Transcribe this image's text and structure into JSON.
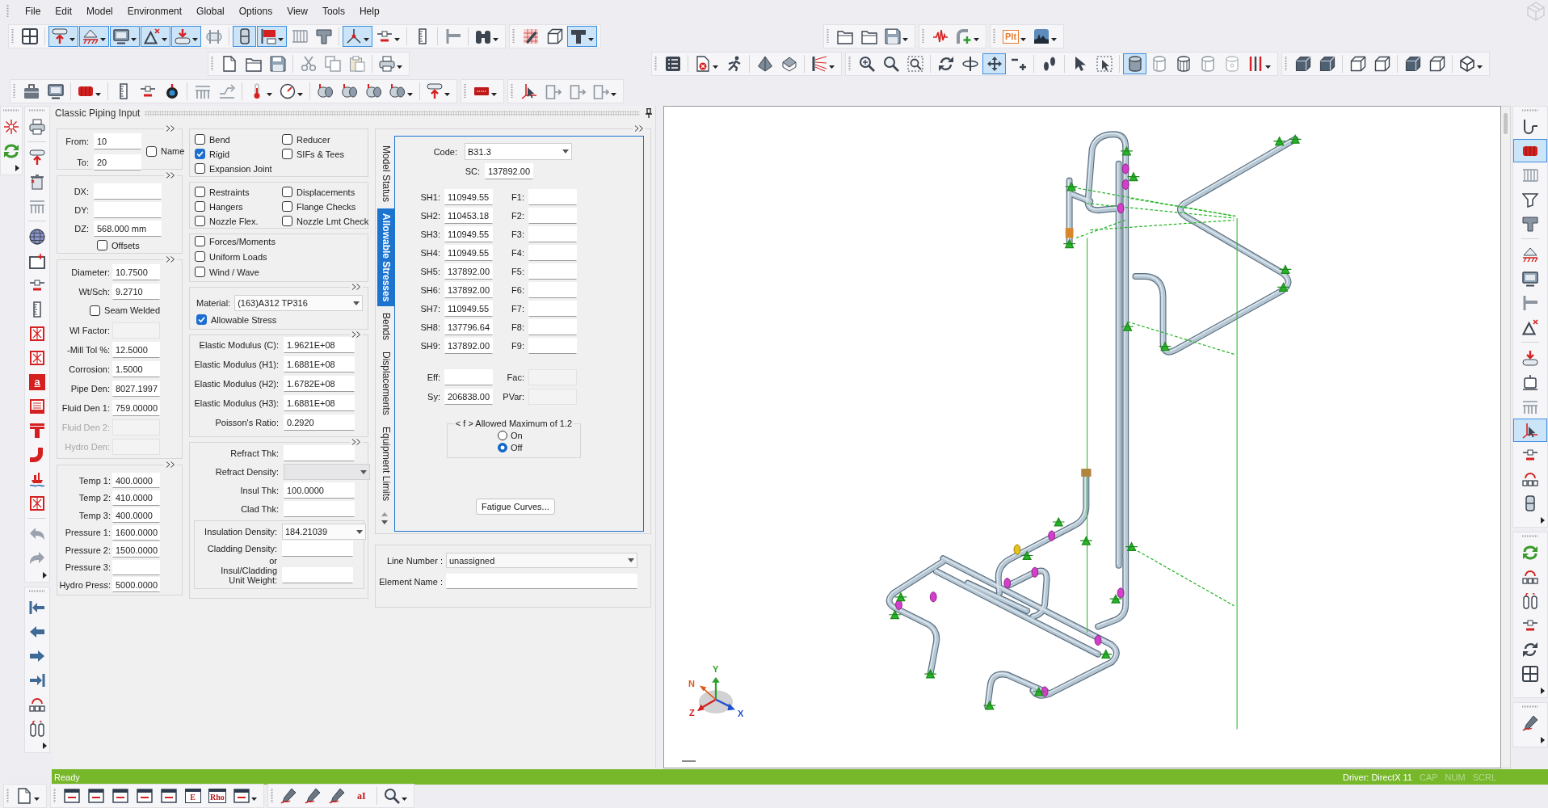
{
  "menu": [
    "File",
    "Edit",
    "Model",
    "Environment",
    "Global",
    "Options",
    "View",
    "Tools",
    "Help"
  ],
  "toolbars": [
    {
      "groups": [
        [
          {
            "selected": false
          }
        ],
        [
          {
            "selected": true
          },
          {
            "selected": true
          },
          {
            "selected": true
          },
          {
            "selected": true
          },
          {
            "selected": true
          },
          {
            "selected": false
          }
        ],
        [
          {
            "selected": true
          },
          {
            "selected": true
          },
          {
            "selected": false
          },
          {
            "selected": false
          }
        ],
        [
          {
            "selected": true
          },
          {
            "selected": false
          }
        ],
        [
          {
            "selected": false
          }
        ],
        [
          {
            "selected": false
          }
        ],
        [
          {
            "selected": false
          }
        ]
      ]
    },
    {
      "groups": [
        [
          {
            "selected": false
          },
          {
            "selected": false
          },
          {
            "selected": true
          }
        ]
      ]
    },
    {
      "groups": [
        [
          {
            "selected": false
          },
          {
            "selected": false
          },
          {
            "selected": false
          }
        ]
      ]
    },
    {
      "groups": [
        [
          {
            "selected": false
          },
          {
            "selected": false
          }
        ]
      ]
    },
    {
      "groups": [
        [
          {
            "selected": false,
            "label": "Plt"
          },
          {
            "selected": false
          }
        ]
      ]
    },
    {
      "groups": [
        [
          {
            "selected": false
          },
          {
            "selected": false
          },
          {
            "selected": false
          }
        ],
        [
          {
            "selected": false
          },
          {
            "selected": false
          },
          {
            "selected": false
          }
        ],
        [
          {
            "selected": false
          }
        ]
      ]
    },
    {
      "groups": [
        [
          {
            "selected": false
          }
        ],
        [
          {
            "selected": false
          },
          {
            "selected": false
          }
        ],
        [
          {
            "selected": false
          },
          {
            "selected": false
          }
        ],
        [
          {
            "selected": false
          }
        ]
      ]
    },
    {
      "groups": [
        [
          {
            "selected": false
          },
          {
            "selected": false
          },
          {
            "selected": false
          }
        ],
        [
          {
            "selected": false
          },
          {
            "selected": false
          },
          {
            "selected": true
          },
          {
            "selected": false
          }
        ],
        [
          {
            "selected": false
          }
        ],
        [
          {
            "selected": false
          },
          {
            "selected": false
          }
        ],
        [
          {
            "selected": true
          },
          {
            "selected": false
          },
          {
            "selected": false
          },
          {
            "selected": false
          },
          {
            "selected": false
          },
          {
            "selected": false
          }
        ]
      ]
    },
    {
      "groups": [
        [
          {
            "selected": false
          },
          {
            "selected": false
          }
        ],
        [
          {
            "selected": false
          },
          {
            "selected": false
          }
        ],
        [
          {
            "selected": false
          },
          {
            "selected": false
          }
        ],
        [
          {
            "selected": false
          }
        ]
      ]
    },
    {
      "groups": [
        [
          {
            "selected": false
          },
          {
            "selected": false
          }
        ],
        [
          {
            "selected": false
          }
        ],
        [
          {
            "selected": false
          },
          {
            "selected": false
          },
          {
            "selected": false
          }
        ],
        [
          {
            "selected": false
          },
          {
            "selected": false
          }
        ],
        [
          {
            "selected": false
          },
          {
            "selected": false
          }
        ],
        [
          {
            "selected": false
          },
          {
            "selected": false
          },
          {
            "selected": false
          },
          {
            "selected": false
          }
        ],
        [
          {
            "selected": false
          }
        ]
      ]
    },
    {
      "groups": [
        [
          {
            "selected": false
          }
        ]
      ]
    },
    {
      "groups": [
        [
          {
            "selected": false
          },
          {
            "selected": false
          },
          {
            "selected": false
          },
          {
            "selected": false
          }
        ]
      ]
    },
    {
      "groups": [
        [
          {
            "selected": false
          },
          {
            "selected": false
          }
        ]
      ]
    },
    {
      "groups": [
        [
          {
            "selected": false
          }
        ],
        [
          {
            "selected": false
          },
          {
            "selected": false
          },
          {
            "selected": false
          }
        ],
        [
          {
            "selected": false
          },
          {
            "selected": false
          },
          {
            "selected": false
          },
          {
            "selected": false
          },
          {
            "selected": false
          },
          {
            "selected": false
          },
          {
            "selected": false,
            "label": "a"
          },
          {
            "selected": false
          },
          {
            "selected": false
          },
          {
            "selected": false
          },
          {
            "selected": false
          },
          {
            "selected": false
          }
        ],
        [
          {
            "selected": false
          },
          {
            "selected": false
          }
        ]
      ]
    },
    {
      "groups": [
        [
          {
            "selected": false
          },
          {
            "selected": false
          },
          {
            "selected": false
          },
          {
            "selected": false
          },
          {
            "selected": false
          },
          {
            "selected": false
          }
        ]
      ]
    },
    {
      "groups": [
        [
          {
            "selected": false
          },
          {
            "selected": true
          },
          {
            "selected": false
          },
          {
            "selected": false
          },
          {
            "selected": false
          }
        ],
        [
          {
            "selected": false
          },
          {
            "selected": false
          },
          {
            "selected": false
          },
          {
            "selected": false
          }
        ],
        [
          {
            "selected": false
          },
          {
            "selected": false
          },
          {
            "selected": false
          },
          {
            "selected": true
          },
          {
            "selected": false
          },
          {
            "selected": false
          },
          {
            "selected": false
          }
        ]
      ]
    },
    {
      "groups": [
        [
          {
            "selected": false
          },
          {
            "selected": false
          },
          {
            "selected": false
          },
          {
            "selected": false
          },
          {
            "selected": false
          },
          {
            "selected": false
          }
        ]
      ]
    },
    {
      "groups": [
        [
          {
            "selected": false
          }
        ]
      ]
    },
    {
      "groups": [
        [
          {
            "selected": false
          }
        ]
      ]
    },
    {
      "groups": [
        [
          {
            "selected": false
          },
          {
            "selected": false
          },
          {
            "selected": false
          },
          {
            "selected": false
          },
          {
            "selected": false
          },
          {
            "selected": false,
            "label": "E"
          },
          {
            "selected": false,
            "label": "Rho"
          },
          {
            "selected": false
          }
        ]
      ]
    },
    {
      "groups": [
        [
          {
            "selected": false
          },
          {
            "selected": false
          },
          {
            "selected": false
          },
          {
            "selected": false,
            "label": "aI"
          }
        ],
        [
          {
            "selected": false
          }
        ]
      ]
    }
  ],
  "panel": {
    "title": "Classic Piping Input",
    "nodes": {
      "fields": [
        {
          "label": "From:",
          "value": "10"
        },
        {
          "label": "To:",
          "value": "20"
        }
      ],
      "name_option": {
        "label": "Name",
        "checked": false
      }
    },
    "deltas": {
      "fields": [
        {
          "label": "DX:"
        },
        {
          "label": "DY:"
        },
        {
          "label": "DZ:",
          "value": "568.000 mm"
        }
      ],
      "offsets": {
        "label": "Offsets",
        "checked": false
      }
    },
    "pipe": {
      "items": [
        {
          "kind": "field",
          "label": "Diameter:",
          "value": "10.7500",
          "readonly": false,
          "disabled": false
        },
        {
          "kind": "field",
          "label": "Wt/Sch:",
          "value": "9.2710",
          "readonly": false,
          "disabled": false
        },
        {
          "kind": "checkbox",
          "label": "Seam Welded",
          "checked": false
        },
        {
          "kind": "field",
          "label": "Wl Factor:",
          "readonly": true,
          "disabled": false
        },
        {
          "kind": "field",
          "label": "-Mill Tol %:",
          "value": "12.5000",
          "readonly": false,
          "disabled": false
        },
        {
          "kind": "field",
          "label": "Corrosion:",
          "value": "1.5000",
          "readonly": false,
          "disabled": false
        },
        {
          "kind": "field",
          "label": "Pipe Den:",
          "value": "8027.1997",
          "readonly": false,
          "disabled": false
        },
        {
          "kind": "field",
          "label": "Fluid Den 1:",
          "value": "759.00000",
          "readonly": false,
          "disabled": false
        },
        {
          "kind": "field",
          "label": "Fluid Den 2:",
          "readonly": false,
          "disabled": true
        },
        {
          "kind": "field",
          "label": "Hydro Den:",
          "readonly": false,
          "disabled": true
        }
      ]
    },
    "conditions": {
      "fields": [
        {
          "label": "Temp 1:",
          "value": "400.0000"
        },
        {
          "label": "Temp 2:",
          "value": "410.0000"
        },
        {
          "label": "Temp 3:",
          "value": "400.0000"
        },
        {
          "label": "Pressure 1:",
          "value": "1600.0000"
        },
        {
          "label": "Pressure 2:",
          "value": "1500.0000"
        },
        {
          "label": "Pressure 3:"
        },
        {
          "label": "Hydro Press:",
          "value": "5000.0000"
        }
      ]
    },
    "option_groups": [
      {
        "options": [
          {
            "label": "Bend",
            "checked": false
          },
          {
            "label": "Reducer",
            "checked": false
          },
          {
            "label": "Rigid",
            "checked": true
          },
          {
            "label": "SIFs & Tees",
            "checked": false
          },
          {
            "label": "Expansion Joint",
            "checked": false
          }
        ]
      },
      {
        "options": [
          {
            "label": "Restraints",
            "checked": false
          },
          {
            "label": "Displacements",
            "checked": false
          },
          {
            "label": "Hangers",
            "checked": false
          },
          {
            "label": "Flange Checks",
            "checked": false
          },
          {
            "label": "Nozzle Flex.",
            "checked": false
          },
          {
            "label": "Nozzle Lmt Check",
            "checked": false
          }
        ]
      },
      {
        "options": [
          {
            "label": "Forces/Moments",
            "checked": false
          },
          {
            "label": "Uniform Loads",
            "checked": false
          },
          {
            "label": "Wind / Wave",
            "checked": false
          }
        ]
      }
    ],
    "material": {
      "label": "Material:",
      "value": "(163)A312 TP316",
      "allowable_stress": {
        "label": "Allowable Stress",
        "checked": true
      }
    },
    "moduli": {
      "fields": [
        {
          "label": "Elastic Modulus (C):",
          "value": "1.9621E+08"
        },
        {
          "label": "Elastic Modulus (H1):",
          "value": "1.6881E+08"
        },
        {
          "label": "Elastic Modulus (H2):",
          "value": "1.6782E+08"
        },
        {
          "label": "Elastic Modulus (H3):",
          "value": "1.6881E+08"
        },
        {
          "label": "Poisson's Ratio:",
          "value": "0.2920"
        }
      ]
    },
    "insulation": {
      "items": [
        {
          "kind": "field",
          "label": "Refract Thk:",
          "readonly": false
        },
        {
          "kind": "dropdown",
          "label": "Refract Density:",
          "readonly": true
        },
        {
          "kind": "field",
          "label": "Insul Thk:",
          "value": "100.0000",
          "readonly": false
        },
        {
          "kind": "field",
          "label": "Clad Thk:",
          "readonly": false
        }
      ],
      "densities": [
        {
          "kind": "dropdown",
          "label": "Insulation Density:",
          "value": "184.21039"
        },
        {
          "kind": "field",
          "label": "Cladding Density:"
        },
        {
          "kind": "note",
          "label": "or"
        },
        {
          "kind": "field",
          "label": "Insul/Cladding\nUnit Weight:"
        }
      ]
    },
    "tabs": [
      {
        "label": "Model Status",
        "selected": false
      },
      {
        "label": "Allowable Stresses",
        "selected": true
      },
      {
        "label": "Bends",
        "selected": false
      },
      {
        "label": "Displacements",
        "selected": false
      },
      {
        "label": "Equipment Limits",
        "selected": false
      }
    ],
    "stresses": {
      "code": {
        "label": "Code:",
        "value": "B31.3"
      },
      "sc": {
        "label": "SC:",
        "value": "137892.00"
      },
      "rows": [
        {
          "sh": {
            "label": "SH1:",
            "value": "110949.55"
          },
          "f": {
            "label": "F1:"
          }
        },
        {
          "sh": {
            "label": "SH2:",
            "value": "110453.18"
          },
          "f": {
            "label": "F2:"
          }
        },
        {
          "sh": {
            "label": "SH3:",
            "value": "110949.55"
          },
          "f": {
            "label": "F3:"
          }
        },
        {
          "sh": {
            "label": "SH4:",
            "value": "110949.55"
          },
          "f": {
            "label": "F4:"
          }
        },
        {
          "sh": {
            "label": "SH5:",
            "value": "137892.00"
          },
          "f": {
            "label": "F5:"
          }
        },
        {
          "sh": {
            "label": "SH6:",
            "value": "137892.00"
          },
          "f": {
            "label": "F6:"
          }
        },
        {
          "sh": {
            "label": "SH7:",
            "value": "110949.55"
          },
          "f": {
            "label": "F7:"
          }
        },
        {
          "sh": {
            "label": "SH8:",
            "value": "137796.64"
          },
          "f": {
            "label": "F8:"
          }
        },
        {
          "sh": {
            "label": "SH9:",
            "value": "137892.00"
          },
          "f": {
            "label": "F9:"
          }
        }
      ],
      "extra": [
        {
          "label": "Eff:",
          "readonly": false
        },
        {
          "label": "Fac:",
          "readonly": true
        },
        {
          "label": "Sy:",
          "value": "206838.00",
          "readonly": false
        },
        {
          "label": "PVar:",
          "readonly": true
        }
      ],
      "allowed_max": {
        "title": "< f > Allowed Maximum of 1.2",
        "options": [
          {
            "label": "On",
            "selected": false
          },
          {
            "label": "Off",
            "selected": true
          }
        ]
      },
      "button": "Fatigue Curves..."
    },
    "line": {
      "line_number": {
        "label": "Line Number :",
        "value": "unassigned"
      },
      "element_name": {
        "label": "Element Name :"
      }
    }
  },
  "viewport": {
    "axis_labels": [
      "N",
      "Y",
      "Z",
      "X"
    ]
  },
  "status_bar": {
    "message": "Ready",
    "driver": "Driver: DirectX 11",
    "indicators": [
      {
        "label": "CAP",
        "on": false
      },
      {
        "label": "NUM",
        "on": false
      },
      {
        "label": "SCRL",
        "on": false
      }
    ]
  }
}
